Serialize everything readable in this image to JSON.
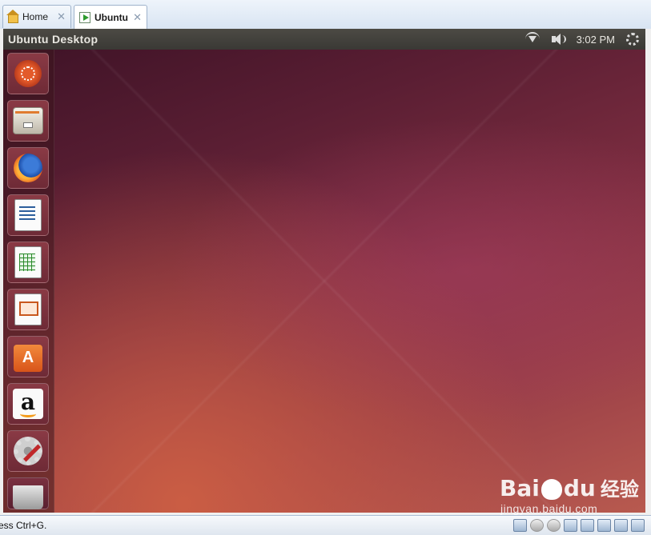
{
  "tabs": [
    {
      "label": "Home",
      "icon": "home-icon",
      "close": "✕"
    },
    {
      "label": "Ubuntu",
      "icon": "vm-icon",
      "close": "✕",
      "active": true
    }
  ],
  "panel": {
    "title": "Ubuntu Desktop",
    "time": "3:02 PM",
    "tray_icons": [
      "wifi-icon",
      "volume-icon",
      "settings-gear-icon"
    ]
  },
  "launcher": {
    "items": [
      {
        "name": "dash-home",
        "icon": "ubuntu-logo-icon"
      },
      {
        "name": "files",
        "icon": "file-cabinet-icon"
      },
      {
        "name": "firefox",
        "icon": "firefox-icon"
      },
      {
        "name": "libreoffice-writer",
        "icon": "writer-document-icon"
      },
      {
        "name": "libreoffice-calc",
        "icon": "calc-spreadsheet-icon"
      },
      {
        "name": "libreoffice-impress",
        "icon": "impress-presentation-icon"
      },
      {
        "name": "software-center",
        "icon": "shopping-bag-icon"
      },
      {
        "name": "amazon",
        "icon": "amazon-icon"
      },
      {
        "name": "system-settings",
        "icon": "wrench-gear-icon"
      },
      {
        "name": "trash",
        "icon": "trash-icon"
      }
    ]
  },
  "statusbar": {
    "message": "ress Ctrl+G.",
    "device_icons": [
      "hdd-icon",
      "cd-icon",
      "cd-icon",
      "floppy-icon",
      "network-icon",
      "printer-icon",
      "sound-icon",
      "message-icon"
    ]
  },
  "watermark": {
    "brand": "Bai",
    "brand_suffix": "du",
    "cn": "经验",
    "url": "jingyan.baidu.com"
  },
  "colors": {
    "panel": "#3c3b37",
    "desktop_dark": "#3f1327",
    "desktop_warm": "#cd5f44",
    "tab_strip": "#d8e4f2"
  }
}
